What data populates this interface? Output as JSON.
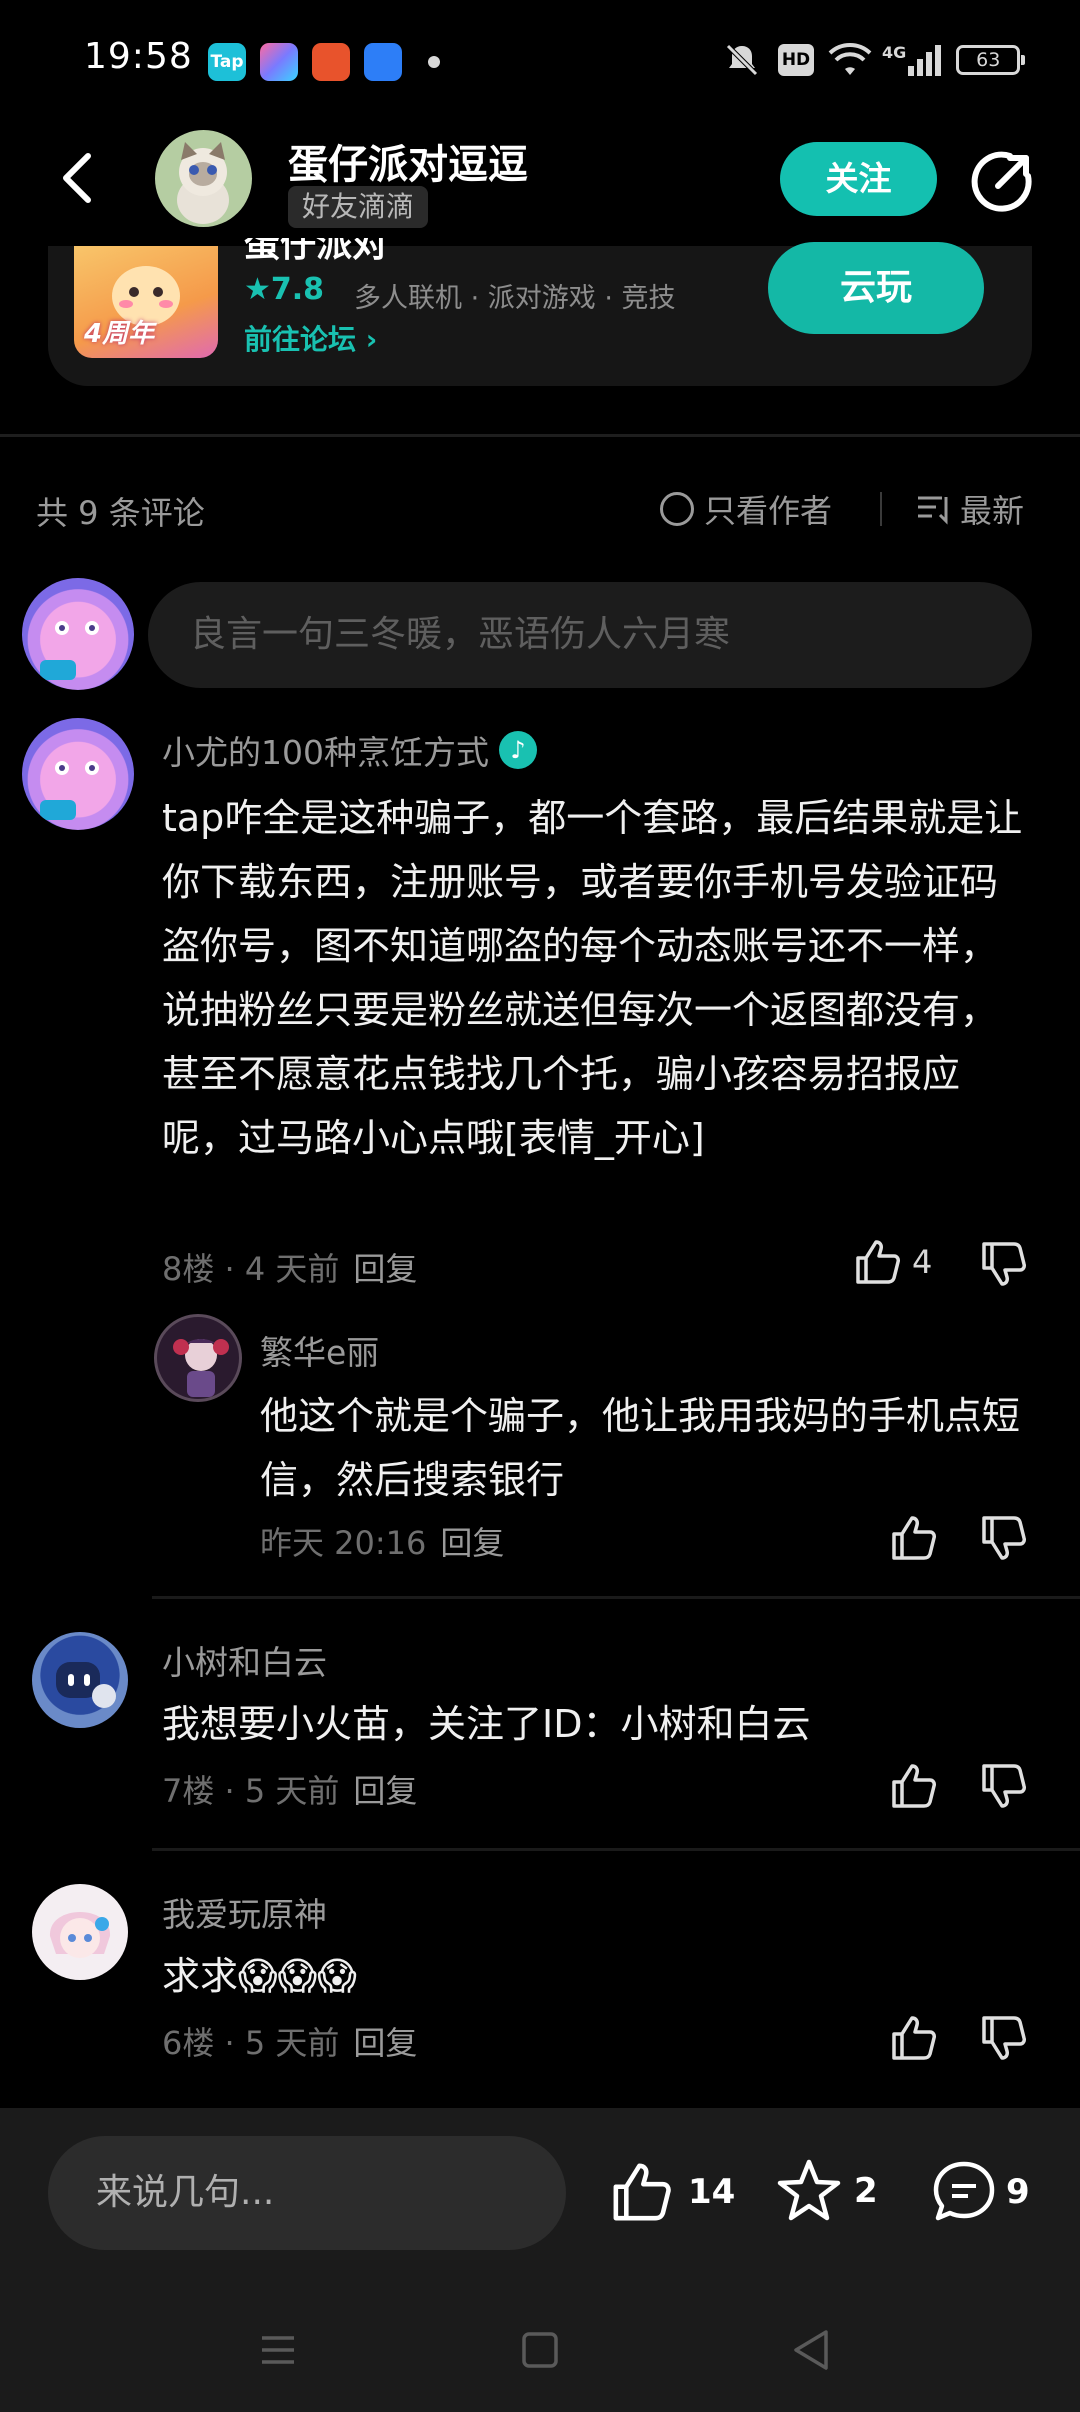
{
  "status_bar": {
    "time": "19:58",
    "app_icons": [
      "taptap-icon",
      "gallery-icon",
      "game-icon",
      "browser-icon"
    ],
    "battery": "63",
    "network": "4G",
    "hd": "HD"
  },
  "header": {
    "title": "蛋仔派对逗逗",
    "subtitle": "好友滴滴",
    "follow_label": "关注"
  },
  "game_card": {
    "name": "蛋仔派对",
    "badge": "4周年",
    "rating": "★7.8",
    "tags": "多人联机 · 派对游戏 · 竞技",
    "forum_link": "前往论坛 ›",
    "cloud_play_label": "云玩"
  },
  "comments_bar": {
    "count_text": "共 9 条评论",
    "author_only_label": "只看作者",
    "sort_label": "最新"
  },
  "comment_input": {
    "placeholder": "良言一句三冬暖，恶语伤人六月寒"
  },
  "comments": [
    {
      "user": "小尤的100种烹饪方式",
      "text": "tap咋全是这种骗子，都一个套路，最后结果就是让你下载东西，注册账号，或者要你手机号发验证码盗你号，图不知道哪盗的每个动态账号还不一样，说抽粉丝只要是粉丝就送但每次一个返图都没有，甚至不愿意花点钱找几个托，骗小孩容易招报应呢，过马路小心点哦[表情_开心]",
      "meta": "8楼 · 4 天前",
      "reply_label": "回复",
      "likes": "4",
      "reply": {
        "user": "繁华e丽",
        "text": "他这个就是个骗子，他让我用我妈的手机点短信，然后搜索银行",
        "meta": "昨天 20:16",
        "reply_label": "回复"
      }
    },
    {
      "user": "小树和白云",
      "text": "我想要小火苗，关注了ID：小树和白云",
      "meta": "7楼 · 5 天前",
      "reply_label": "回复"
    },
    {
      "user": "我爱玩原神",
      "text": "求求😱😱😱",
      "meta": "6楼 · 5 天前",
      "reply_label": "回复"
    }
  ],
  "bottom_bar": {
    "input_placeholder": "来说几句...",
    "likes": "14",
    "favorites": "2",
    "comments": "9"
  },
  "colors": {
    "accent": "#14c0b0",
    "background": "#000000"
  }
}
